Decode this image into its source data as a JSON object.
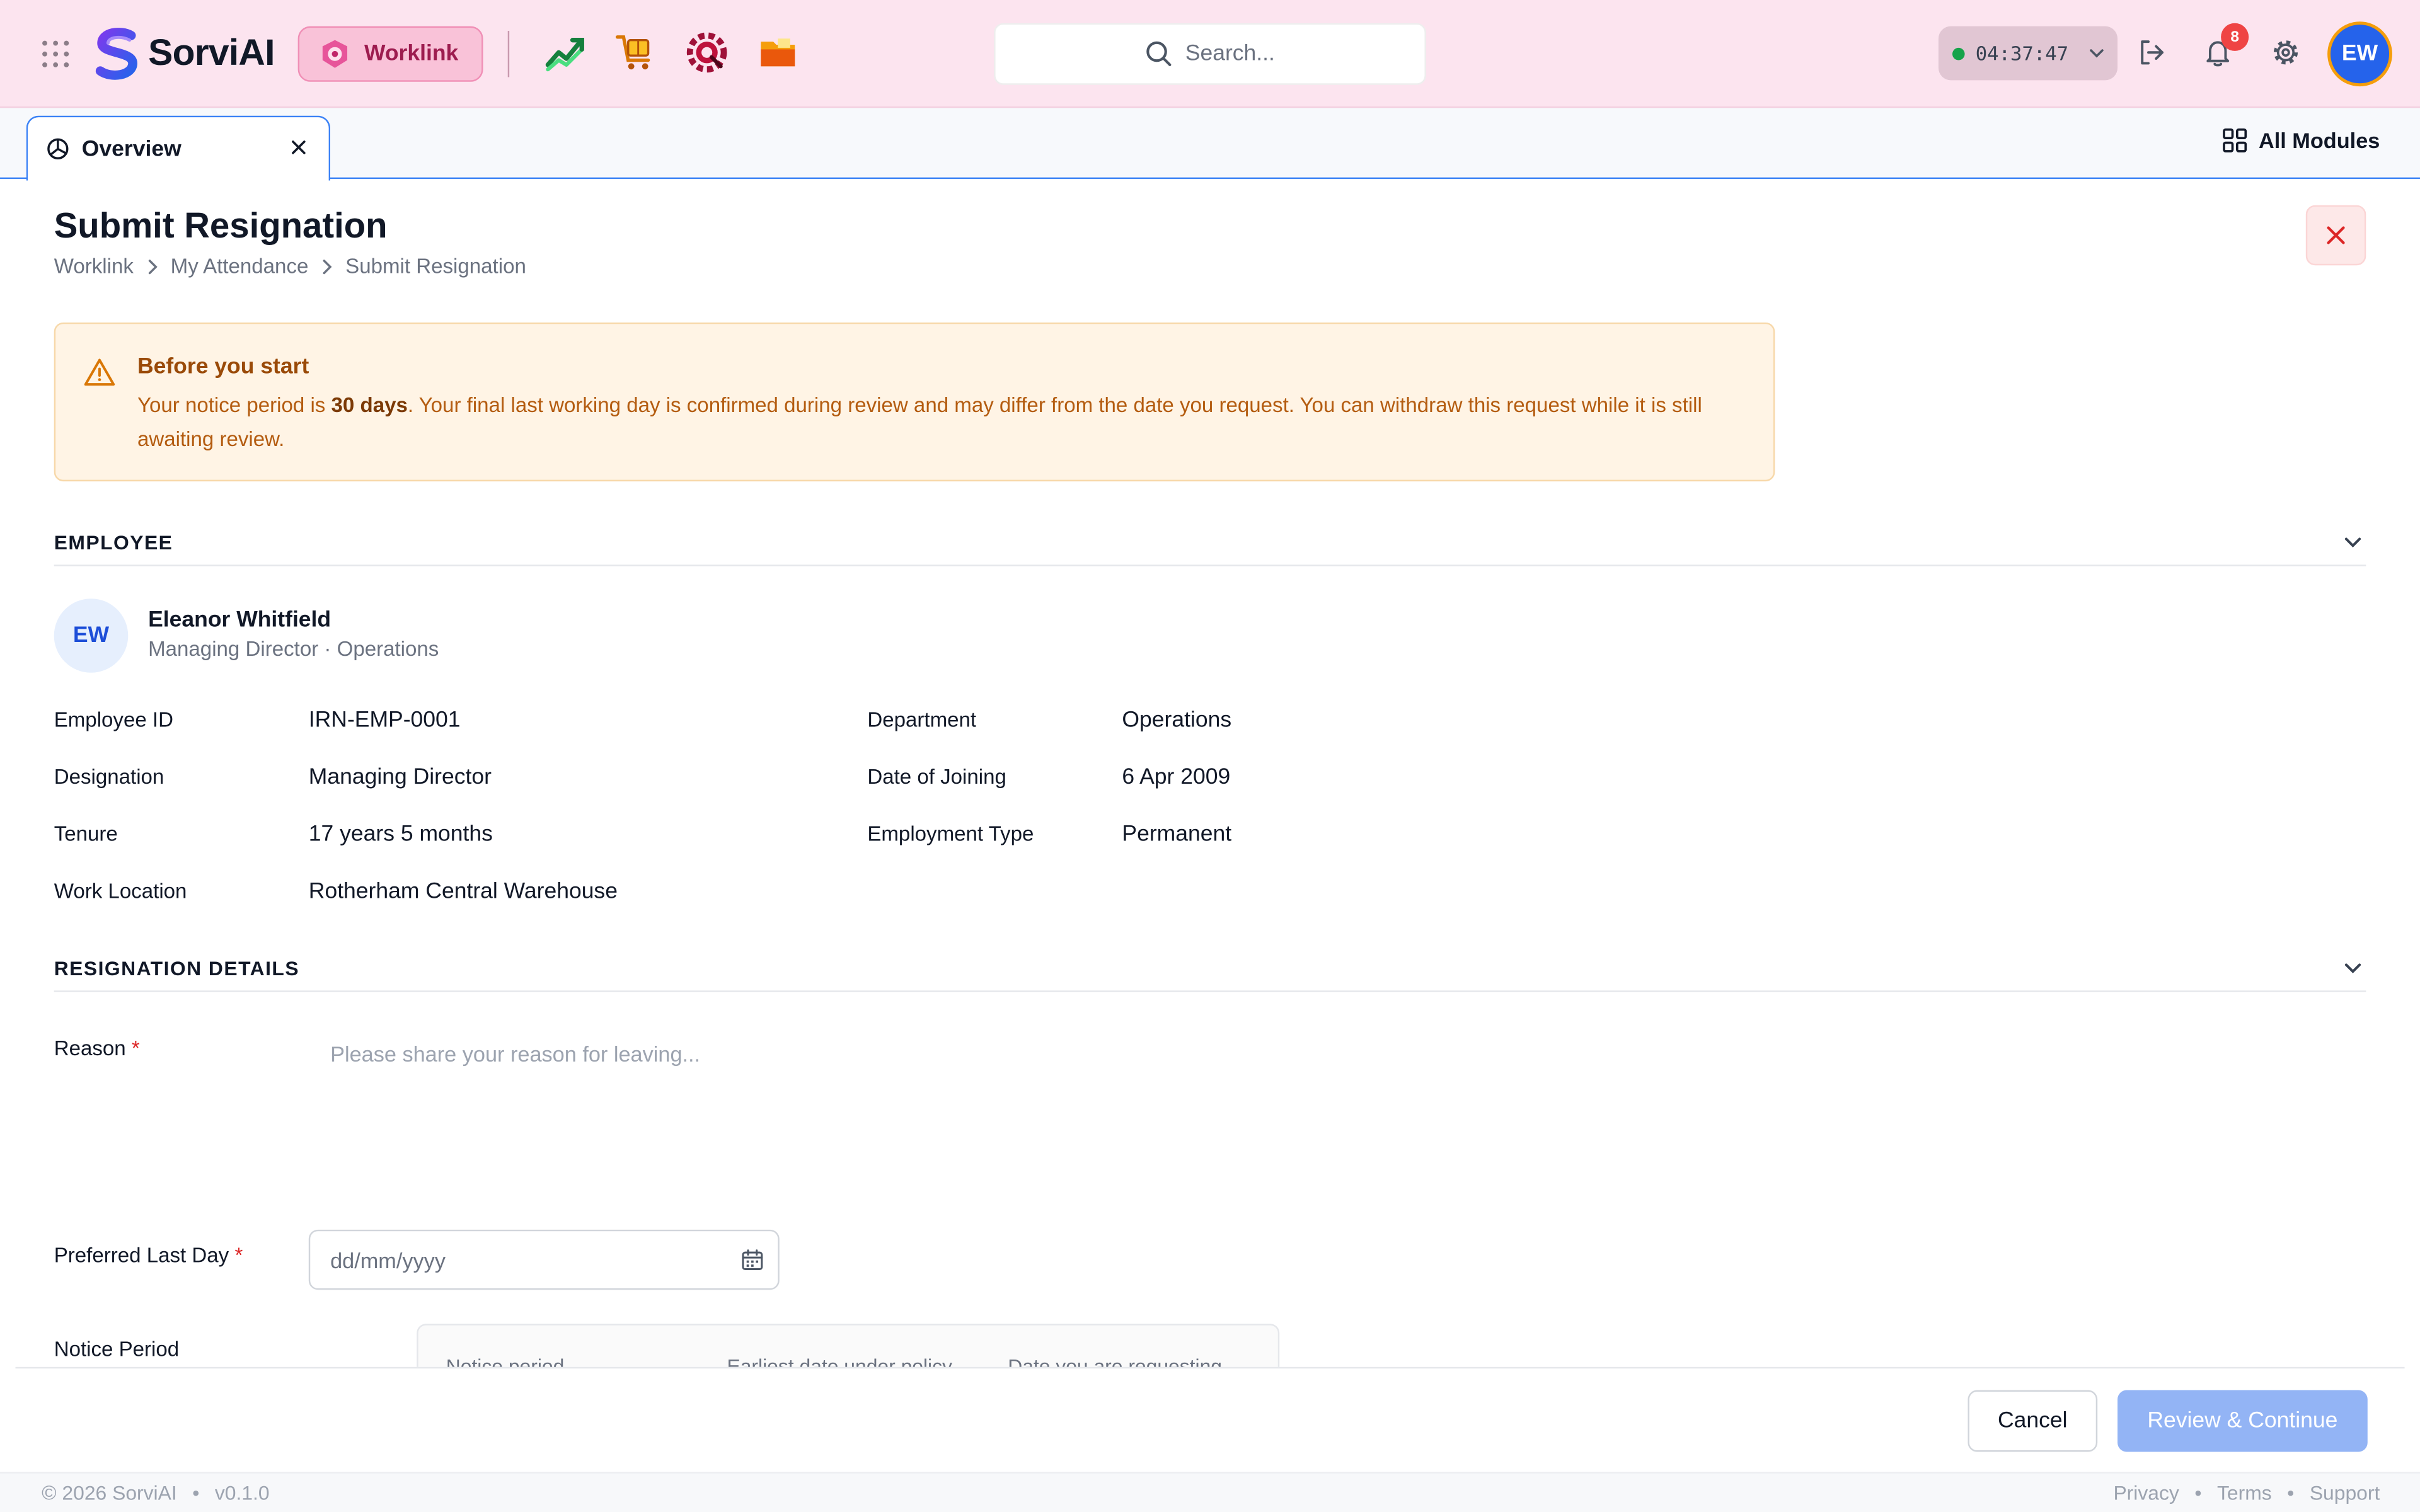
{
  "brand": {
    "name": "SorviAI"
  },
  "header": {
    "active_module": "Worklink",
    "search_placeholder": "Search...",
    "timer": "04:37:47",
    "notifications_count": "8",
    "user_initials": "EW"
  },
  "tabs": [
    {
      "label": "Overview"
    }
  ],
  "all_modules_label": "All Modules",
  "page": {
    "title": "Submit Resignation",
    "breadcrumb": [
      "Worklink",
      "My Attendance",
      "Submit Resignation"
    ]
  },
  "alert": {
    "heading": "Before you start",
    "text_1": "Your notice period is ",
    "bold": "30 days",
    "text_2": ". Your final last working day is confirmed during review and may differ from the date you request. You can withdraw this request while it is still awaiting review."
  },
  "employee_section": {
    "title": "EMPLOYEE",
    "initials": "EW",
    "name": "Eleanor Whitfield",
    "subtitle": "Managing Director · Operations",
    "fields": [
      {
        "label": "Employee ID",
        "value": "IRN-EMP-0001"
      },
      {
        "label": "Department",
        "value": "Operations"
      },
      {
        "label": "Designation",
        "value": "Managing Director"
      },
      {
        "label": "Date of Joining",
        "value": "6 Apr 2009"
      },
      {
        "label": "Tenure",
        "value": "17 years 5 months"
      },
      {
        "label": "Employment Type",
        "value": "Permanent"
      },
      {
        "label": "Work Location",
        "value": "Rotherham Central Warehouse"
      }
    ]
  },
  "resignation_section": {
    "title": "RESIGNATION DETAILS",
    "reason_label": "Reason",
    "reason_placeholder": "Please share your reason for leaving...",
    "last_day_label": "Preferred Last Day",
    "last_day_placeholder": "dd/mm/yyyy",
    "notice_label": "Notice Period",
    "notice_columns": [
      "Notice period",
      "Earliest date under policy",
      "Date you are requesting"
    ],
    "required_mark": "*"
  },
  "actions": {
    "cancel": "Cancel",
    "review": "Review & Continue"
  },
  "footer": {
    "copyright": "© 2026 SorviAI",
    "version": "v0.1.0",
    "links": [
      "Privacy",
      "Terms",
      "Support"
    ],
    "bullet": "•"
  },
  "colors": {
    "topbar_bg": "#fce4ef",
    "accent": "#3b82f6",
    "module_pill": "#f9c2d8",
    "warning_bg": "#fff4e5",
    "primary_disabled": "#93b4f5",
    "danger": "#dc2626"
  }
}
